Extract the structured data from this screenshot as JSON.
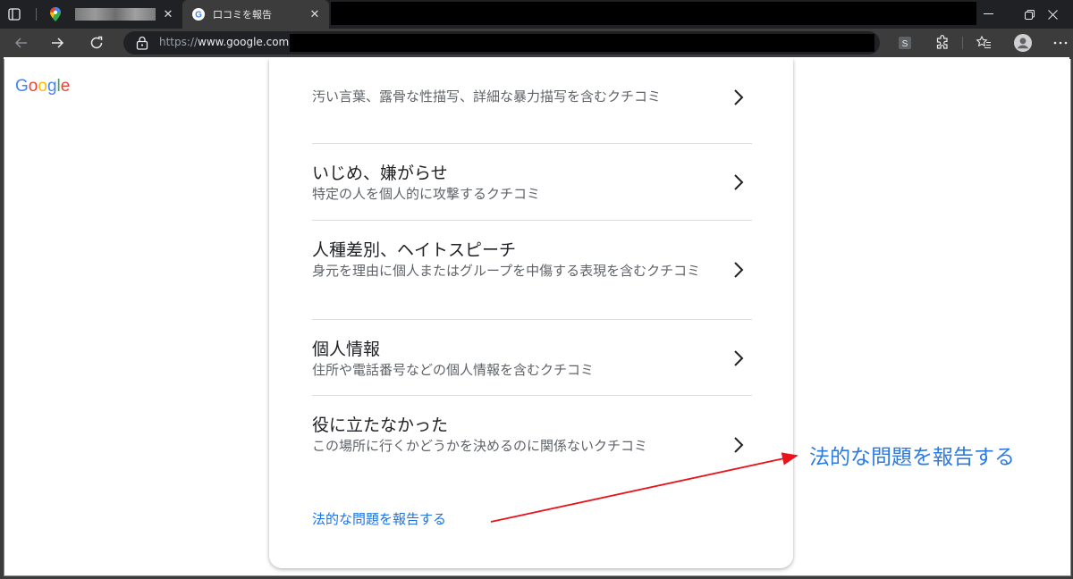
{
  "browser": {
    "tabs": [
      {
        "title": "",
        "favicon": "maps-pin-icon",
        "active": false
      },
      {
        "title": "口コミを報告",
        "favicon": "google-g-icon",
        "active": true
      }
    ],
    "url_scheme": "https://",
    "url_host": "www.google.com"
  },
  "logo": [
    "G",
    "o",
    "o",
    "g",
    "l",
    "e"
  ],
  "colors": {
    "logo": [
      "#4285F4",
      "#EA4335",
      "#FBBC05",
      "#4285F4",
      "#34A853",
      "#EA4335"
    ],
    "link": "#1a73e8",
    "annotation": "#e8141b"
  },
  "options": [
    {
      "title": "",
      "desc": "汚い言葉、露骨な性描写、詳細な暴力描写を含むクチコミ"
    },
    {
      "title": "いじめ、嫌がらせ",
      "desc": "特定の人を個人的に攻撃するクチコミ"
    },
    {
      "title": "人種差別、ヘイトスピーチ",
      "desc": "身元を理由に個人またはグループを中傷する表現を含むクチコミ"
    },
    {
      "title": "個人情報",
      "desc": "住所や電話番号などの個人情報を含むクチコミ"
    },
    {
      "title": "役に立たなかった",
      "desc": "この場所に行くかどうかを決めるのに関係ないクチコミ"
    }
  ],
  "legal_link": "法的な問題を報告する",
  "annotation_label": "法的な問題を報告する"
}
